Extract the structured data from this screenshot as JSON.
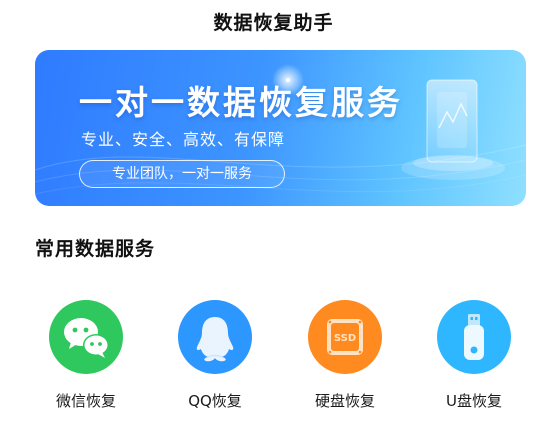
{
  "page": {
    "title": "数据恢复助手"
  },
  "banner": {
    "headline": "一对一数据恢复服务",
    "subline": "专业、安全、高效、有保障",
    "pill": "专业团队，一对一服务"
  },
  "services": {
    "section_title": "常用数据服务",
    "items": [
      {
        "label": "微信恢复",
        "icon": "wechat-icon",
        "color": "#2fc85f"
      },
      {
        "label": "QQ恢复",
        "icon": "qq-icon",
        "color": "#2b97ff"
      },
      {
        "label": "硬盘恢复",
        "icon": "ssd-icon",
        "color": "#ff8a1f"
      },
      {
        "label": "U盘恢复",
        "icon": "usb-icon",
        "color": "#2eb6ff"
      }
    ]
  }
}
